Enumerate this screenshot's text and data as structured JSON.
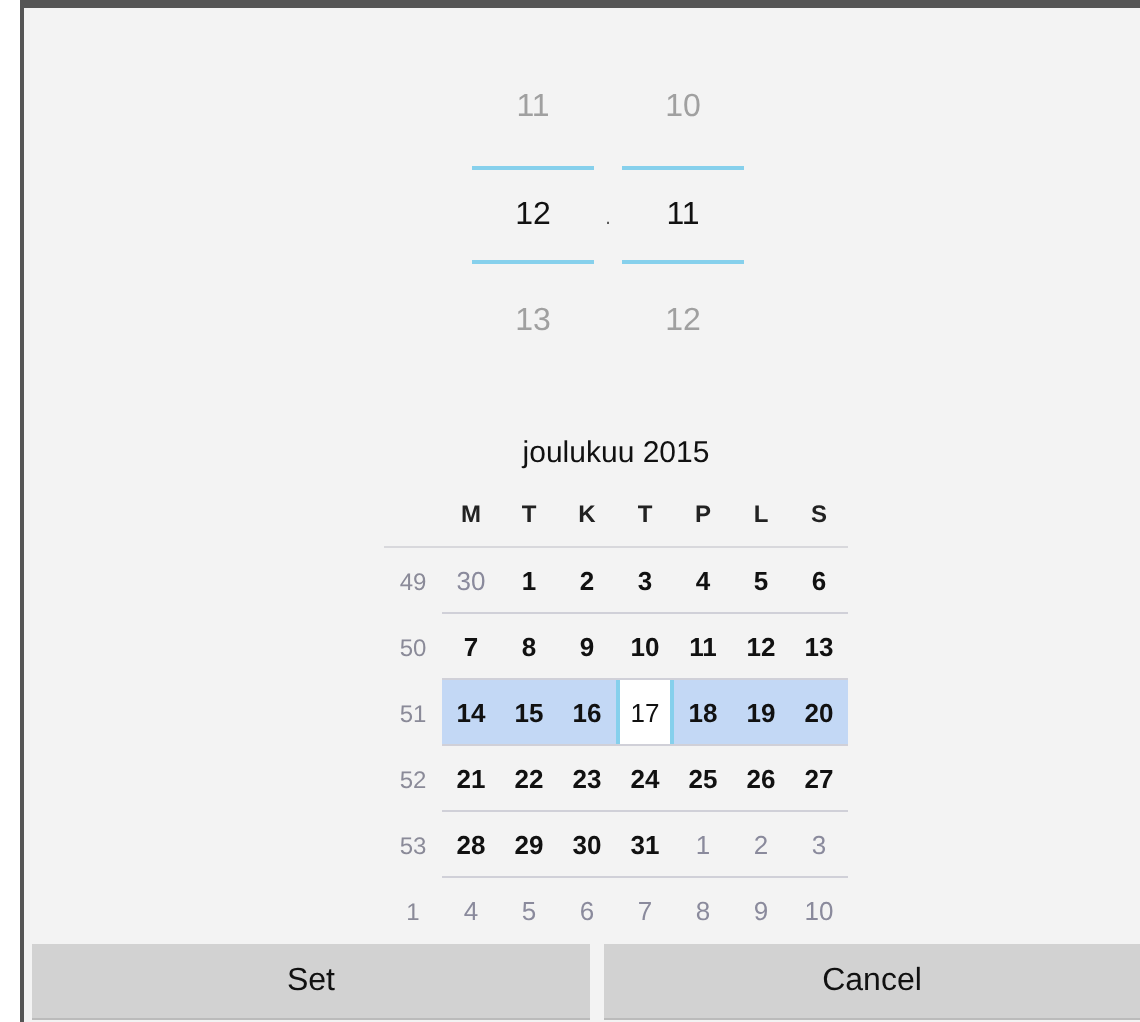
{
  "time_picker": {
    "separator": ".",
    "columns": [
      {
        "previous": "11",
        "value": "12",
        "next": "13"
      },
      {
        "previous": "10",
        "value": "11",
        "next": "12"
      }
    ]
  },
  "calendar": {
    "title": "joulukuu 2015",
    "weekdays": [
      "M",
      "T",
      "K",
      "T",
      "P",
      "L",
      "S"
    ],
    "weeks": [
      {
        "number": "49",
        "selected": false,
        "days": [
          {
            "label": "30",
            "in_month": false,
            "selected": false
          },
          {
            "label": "1",
            "in_month": true,
            "selected": false
          },
          {
            "label": "2",
            "in_month": true,
            "selected": false
          },
          {
            "label": "3",
            "in_month": true,
            "selected": false
          },
          {
            "label": "4",
            "in_month": true,
            "selected": false
          },
          {
            "label": "5",
            "in_month": true,
            "selected": false
          },
          {
            "label": "6",
            "in_month": true,
            "selected": false
          }
        ]
      },
      {
        "number": "50",
        "selected": false,
        "days": [
          {
            "label": "7",
            "in_month": true,
            "selected": false
          },
          {
            "label": "8",
            "in_month": true,
            "selected": false
          },
          {
            "label": "9",
            "in_month": true,
            "selected": false
          },
          {
            "label": "10",
            "in_month": true,
            "selected": false
          },
          {
            "label": "11",
            "in_month": true,
            "selected": false
          },
          {
            "label": "12",
            "in_month": true,
            "selected": false
          },
          {
            "label": "13",
            "in_month": true,
            "selected": false
          }
        ]
      },
      {
        "number": "51",
        "selected": true,
        "days": [
          {
            "label": "14",
            "in_month": true,
            "selected": false
          },
          {
            "label": "15",
            "in_month": true,
            "selected": false
          },
          {
            "label": "16",
            "in_month": true,
            "selected": false
          },
          {
            "label": "17",
            "in_month": true,
            "selected": true
          },
          {
            "label": "18",
            "in_month": true,
            "selected": false
          },
          {
            "label": "19",
            "in_month": true,
            "selected": false
          },
          {
            "label": "20",
            "in_month": true,
            "selected": false
          }
        ]
      },
      {
        "number": "52",
        "selected": false,
        "days": [
          {
            "label": "21",
            "in_month": true,
            "selected": false
          },
          {
            "label": "22",
            "in_month": true,
            "selected": false
          },
          {
            "label": "23",
            "in_month": true,
            "selected": false
          },
          {
            "label": "24",
            "in_month": true,
            "selected": false
          },
          {
            "label": "25",
            "in_month": true,
            "selected": false
          },
          {
            "label": "26",
            "in_month": true,
            "selected": false
          },
          {
            "label": "27",
            "in_month": true,
            "selected": false
          }
        ]
      },
      {
        "number": "53",
        "selected": false,
        "days": [
          {
            "label": "28",
            "in_month": true,
            "selected": false
          },
          {
            "label": "29",
            "in_month": true,
            "selected": false
          },
          {
            "label": "30",
            "in_month": true,
            "selected": false
          },
          {
            "label": "31",
            "in_month": true,
            "selected": false
          },
          {
            "label": "1",
            "in_month": false,
            "selected": false
          },
          {
            "label": "2",
            "in_month": false,
            "selected": false
          },
          {
            "label": "3",
            "in_month": false,
            "selected": false
          }
        ]
      },
      {
        "number": "1",
        "selected": false,
        "days": [
          {
            "label": "4",
            "in_month": false,
            "selected": false
          },
          {
            "label": "5",
            "in_month": false,
            "selected": false
          },
          {
            "label": "6",
            "in_month": false,
            "selected": false
          },
          {
            "label": "7",
            "in_month": false,
            "selected": false
          },
          {
            "label": "8",
            "in_month": false,
            "selected": false
          },
          {
            "label": "9",
            "in_month": false,
            "selected": false
          },
          {
            "label": "10",
            "in_month": false,
            "selected": false
          }
        ]
      }
    ]
  },
  "buttons": [
    "Set",
    "Cancel"
  ]
}
